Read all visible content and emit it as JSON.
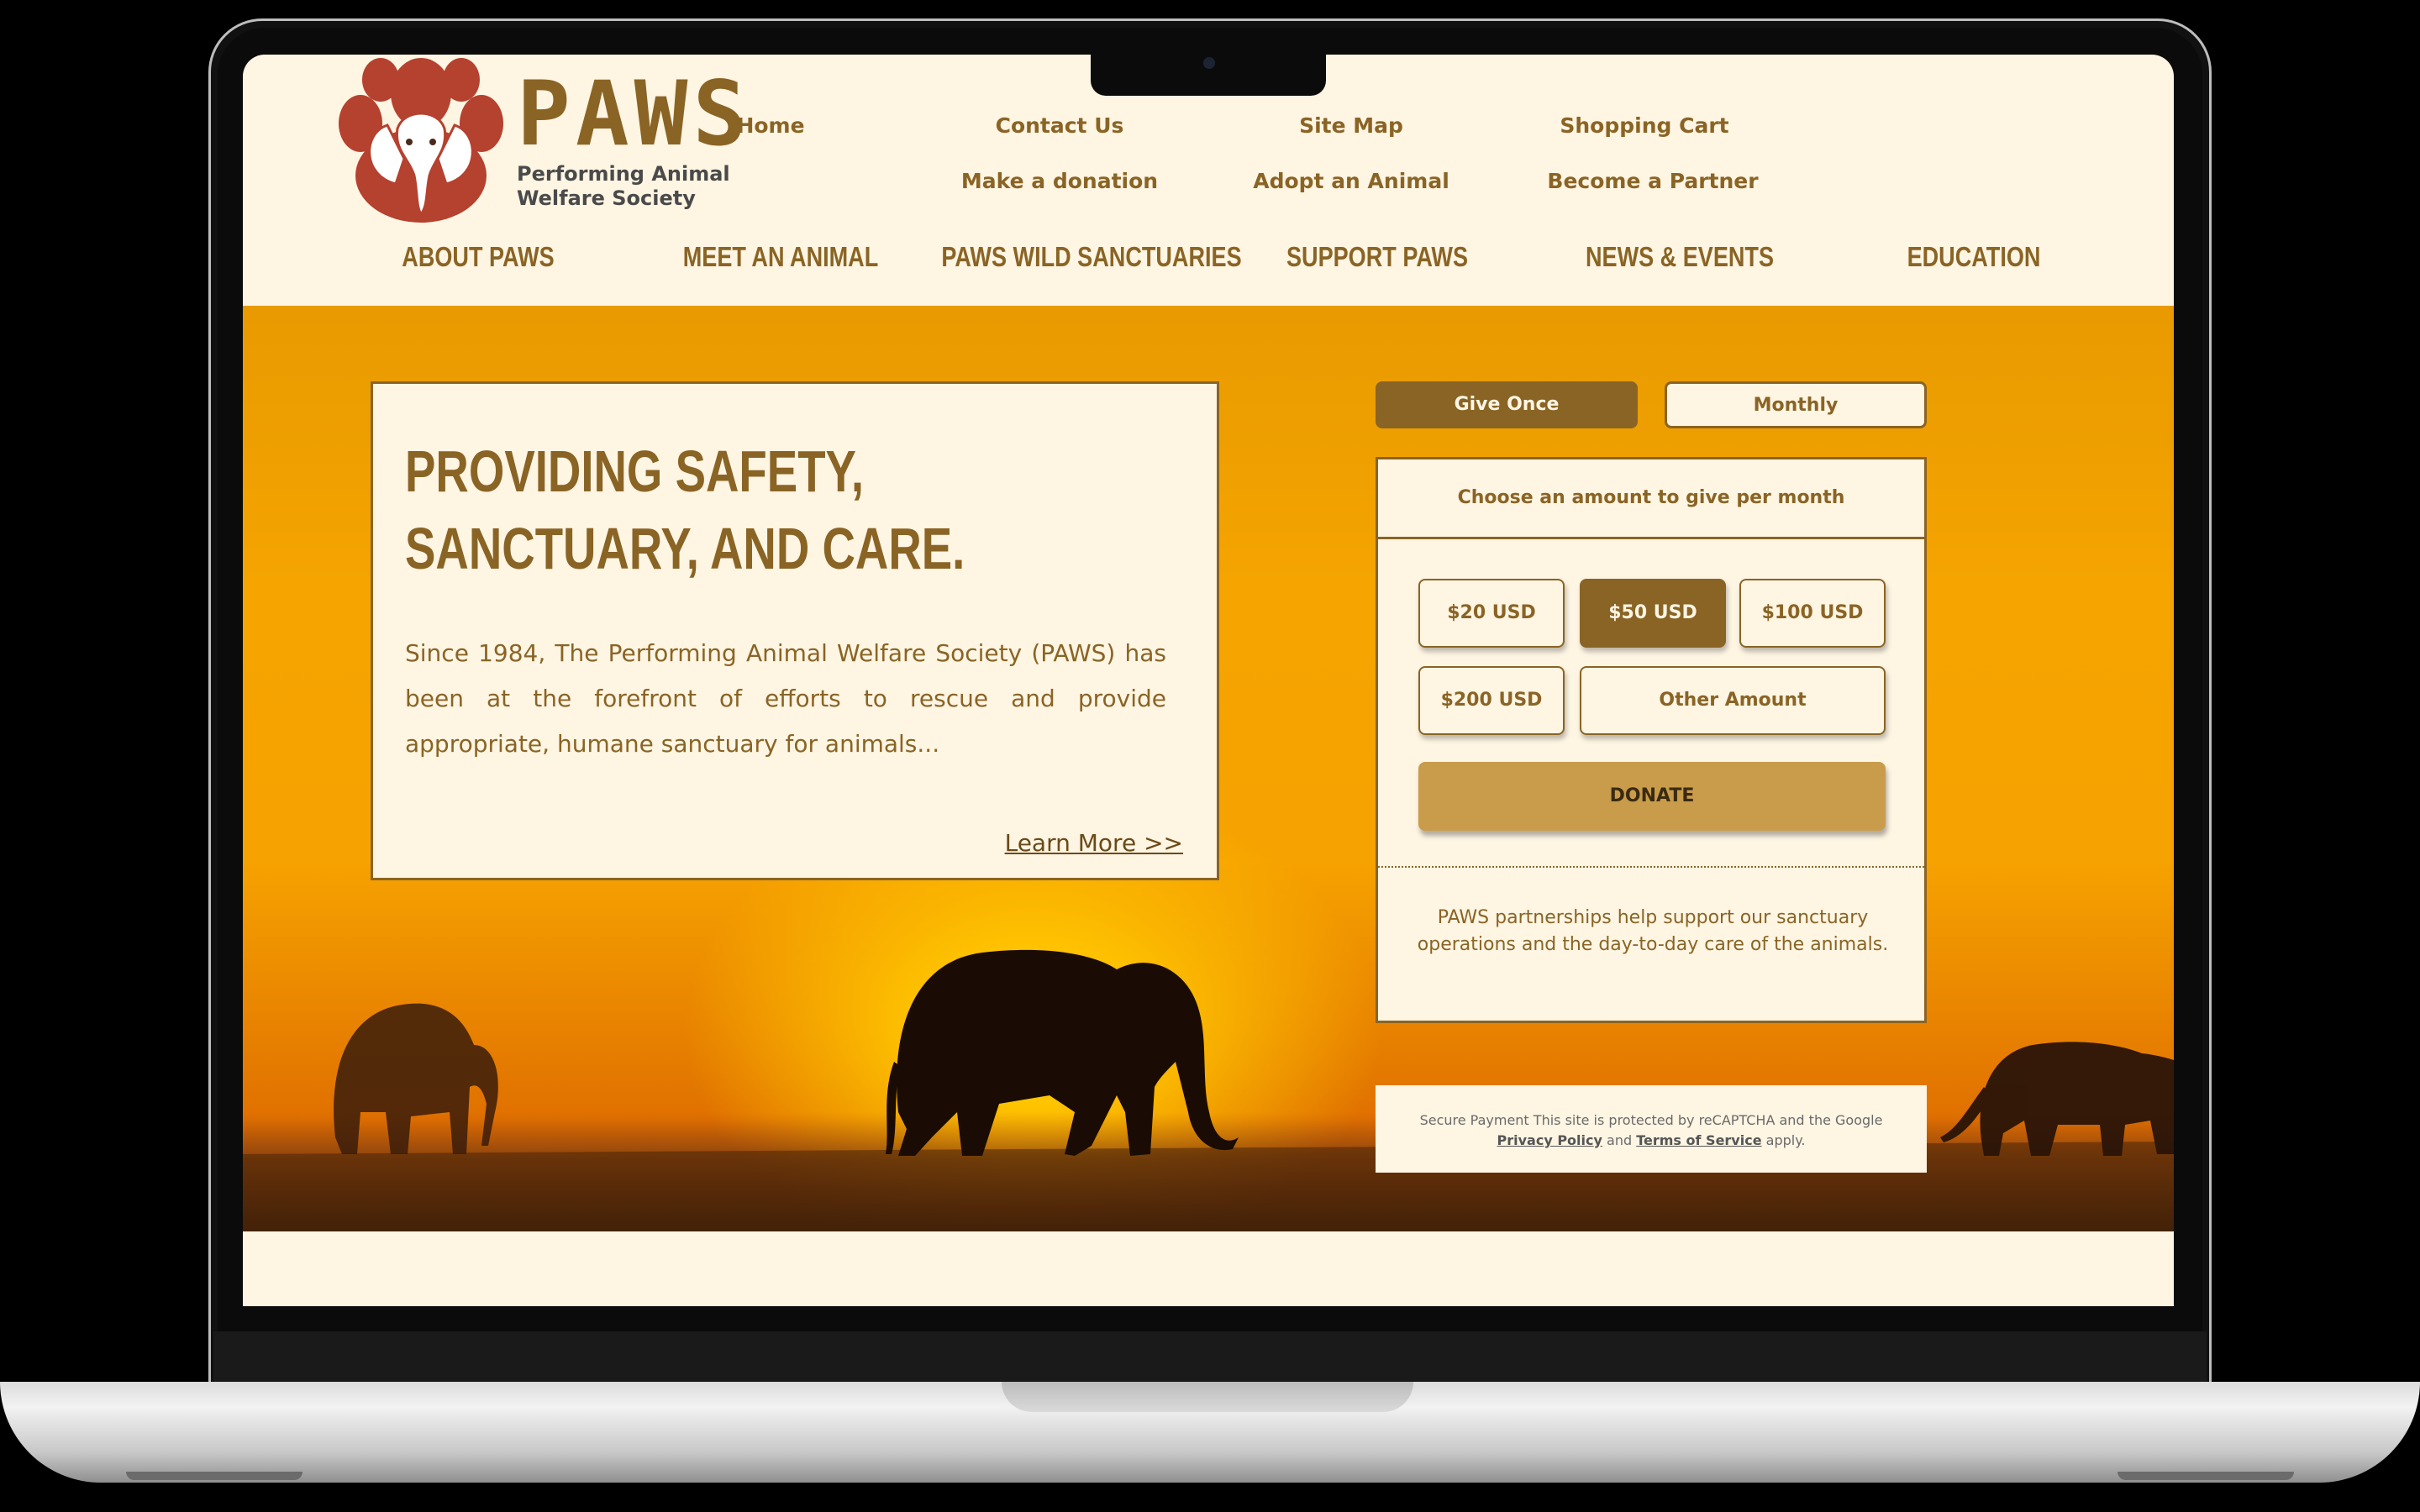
{
  "site": {
    "brand": "PAWS",
    "subtitle": "Performing Animal Welfare Society"
  },
  "top_links": {
    "home": "Home",
    "contact": "Contact Us",
    "sitemap": "Site Map",
    "cart": "Shopping Cart",
    "donation": "Make a donation",
    "adopt": "Adopt an Animal",
    "partner": "Become a Partner"
  },
  "main_nav": [
    "ABOUT PAWS",
    "MEET AN ANIMAL",
    "PAWS WILD SANCTUARIES",
    "SUPPORT PAWS",
    "NEWS & EVENTS",
    "EDUCATION"
  ],
  "intro": {
    "heading_line1": "PROVIDING SAFETY,",
    "heading_line2": "SANCTUARY, AND CARE.",
    "body": "Since 1984, The Performing Animal Welfare Society (PAWS) has been at the forefront of efforts to rescue and provide appropriate, humane sanctuary for animals...",
    "link": "Learn More >>"
  },
  "donation": {
    "tab_once": "Give Once",
    "tab_monthly": "Monthly",
    "prompt": "Choose an amount to give per month",
    "amounts": [
      "$20 USD",
      "$50 USD",
      "$100 USD",
      "$200 USD"
    ],
    "other": "Other Amount",
    "selected": "$50 USD",
    "donate_label": "DONATE",
    "partner_note": "PAWS partnerships help support our sanctuary operations and the day-to-day care of the animals."
  },
  "secure": {
    "prefix": "Secure Payment  This site is protected by reCAPTCHA and the Google",
    "privacy": "Privacy Policy",
    "and": "and",
    "terms": "Terms of Service",
    "suffix": "apply."
  },
  "colors": {
    "brand_brown": "#8a6425",
    "cream": "#fef5e3",
    "donate_gold": "#c99c4c",
    "logo_red": "#b5412f"
  }
}
